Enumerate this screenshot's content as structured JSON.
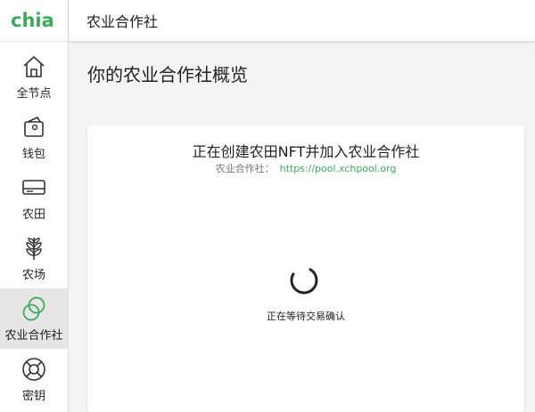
{
  "app": {
    "logo_text": "chia",
    "brand_color": "#3aac59"
  },
  "sidebar": {
    "items": [
      {
        "label": "全节点",
        "icon": "home-icon"
      },
      {
        "label": "钱包",
        "icon": "wallet-icon"
      },
      {
        "label": "农田",
        "icon": "plot-drive-icon"
      },
      {
        "label": "农场",
        "icon": "farm-sprout-icon"
      },
      {
        "label": "农业合作社",
        "icon": "pool-circles-icon",
        "active": true
      },
      {
        "label": "密钥",
        "icon": "keys-lifebuoy-icon"
      }
    ]
  },
  "header": {
    "title": "农业合作社"
  },
  "main": {
    "page_title": "你的农业合作社概览",
    "card": {
      "title": "正在创建农田NFT并加入农业合作社",
      "pool_label": "农业合作社：",
      "pool_url": "https://pool.xchpool.org",
      "status_text": "正在等待交易确认"
    }
  }
}
